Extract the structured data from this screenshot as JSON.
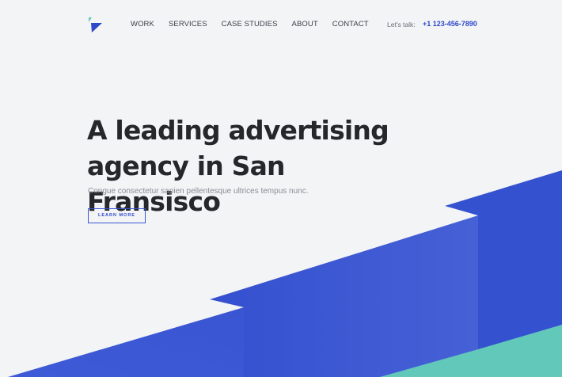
{
  "header": {
    "logo_name": "brand-logo",
    "nav": [
      {
        "label": "WORK"
      },
      {
        "label": "SERVICES"
      },
      {
        "label": "CASE STUDIES"
      },
      {
        "label": "ABOUT"
      },
      {
        "label": "CONTACT"
      }
    ],
    "talk_label": "Let's talk:",
    "phone": "+1 123-456-7890"
  },
  "hero": {
    "title_line1": "A leading advertising",
    "title_line2": "agency in San Fransisco",
    "subtitle": "Congue consectetur sapien pellentesque ultrices tempus nunc.",
    "cta_label": "LEARN MORE"
  },
  "colors": {
    "accent": "#3650d0",
    "teal": "#62c8b9",
    "background": "#f3f4f6",
    "heading": "#26272b"
  }
}
